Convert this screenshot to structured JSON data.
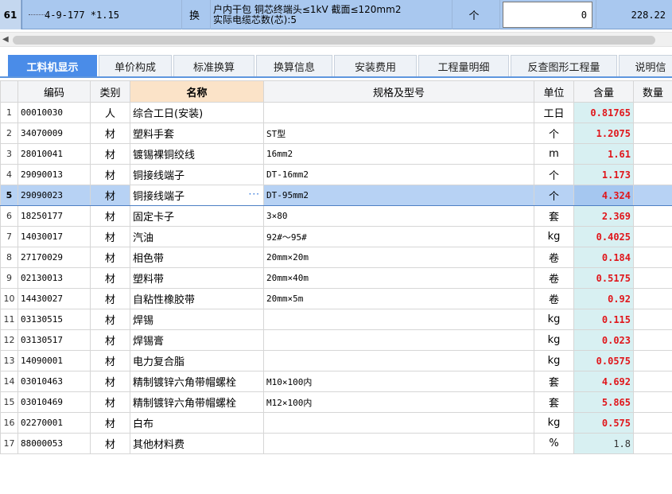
{
  "top_row": {
    "row_num": "61",
    "code": "4-9-177 *1.15",
    "mark": "换",
    "desc_line1": "户内干包 铜芯终端头≤1kV 截面≤120mm2",
    "desc_line2": "实际电缆芯数(芯):5",
    "unit": "个",
    "quantity_input": "0",
    "price": "228.22"
  },
  "tabs": [
    {
      "label": "工料机显示",
      "active": true
    },
    {
      "label": "单价构成"
    },
    {
      "label": "标准换算"
    },
    {
      "label": "换算信息"
    },
    {
      "label": "安装费用"
    },
    {
      "label": "工程量明细"
    },
    {
      "label": "反查图形工程量"
    },
    {
      "label": "说明信"
    }
  ],
  "columns": {
    "code": "编码",
    "type": "类别",
    "name": "名称",
    "spec": "规格及型号",
    "unit": "单位",
    "qty": "含量",
    "amount": "数量"
  },
  "rows": [
    {
      "n": "1",
      "code": "00010030",
      "type": "人",
      "name": "综合工日(安装)",
      "spec": "",
      "unit": "工日",
      "qty": "0.81765"
    },
    {
      "n": "2",
      "code": "34070009",
      "type": "材",
      "name": "塑料手套",
      "spec": "ST型",
      "unit": "个",
      "qty": "1.2075"
    },
    {
      "n": "3",
      "code": "28010041",
      "type": "材",
      "name": "镀锡裸铜绞线",
      "spec": "16mm2",
      "unit": "m",
      "qty": "1.61"
    },
    {
      "n": "4",
      "code": "29090013",
      "type": "材",
      "name": "铜接线端子",
      "spec": "DT-16mm2",
      "unit": "个",
      "qty": "1.173"
    },
    {
      "n": "5",
      "code": "29090023",
      "type": "材",
      "name": "铜接线端子",
      "spec": "DT-95mm2",
      "unit": "个",
      "qty": "4.324",
      "selected": true
    },
    {
      "n": "6",
      "code": "18250177",
      "type": "材",
      "name": "固定卡子",
      "spec": "3×80",
      "unit": "套",
      "qty": "2.369"
    },
    {
      "n": "7",
      "code": "14030017",
      "type": "材",
      "name": "汽油",
      "spec": "92#～95#",
      "unit": "kg",
      "qty": "0.4025"
    },
    {
      "n": "8",
      "code": "27170029",
      "type": "材",
      "name": "相色带",
      "spec": "20mm×20m",
      "unit": "卷",
      "qty": "0.184"
    },
    {
      "n": "9",
      "code": "02130013",
      "type": "材",
      "name": "塑料带",
      "spec": "20mm×40m",
      "unit": "卷",
      "qty": "0.5175"
    },
    {
      "n": "10",
      "code": "14430027",
      "type": "材",
      "name": "自粘性橡胶带",
      "spec": "20mm×5m",
      "unit": "卷",
      "qty": "0.92"
    },
    {
      "n": "11",
      "code": "03130515",
      "type": "材",
      "name": "焊锡",
      "spec": "",
      "unit": "kg",
      "qty": "0.115"
    },
    {
      "n": "12",
      "code": "03130517",
      "type": "材",
      "name": "焊锡膏",
      "spec": "",
      "unit": "kg",
      "qty": "0.023"
    },
    {
      "n": "13",
      "code": "14090001",
      "type": "材",
      "name": "电力复合脂",
      "spec": "",
      "unit": "kg",
      "qty": "0.0575"
    },
    {
      "n": "14",
      "code": "03010463",
      "type": "材",
      "name": "精制镀锌六角带帽螺栓",
      "spec": "M10×100内",
      "unit": "套",
      "qty": "4.692"
    },
    {
      "n": "15",
      "code": "03010469",
      "type": "材",
      "name": "精制镀锌六角带帽螺栓",
      "spec": "M12×100内",
      "unit": "套",
      "qty": "5.865"
    },
    {
      "n": "16",
      "code": "02270001",
      "type": "材",
      "name": "白布",
      "spec": "",
      "unit": "kg",
      "qty": "0.575"
    },
    {
      "n": "17",
      "code": "88000053",
      "type": "材",
      "name": "其他材料费",
      "spec": "",
      "unit": "%",
      "qty": "1.8",
      "plain": true
    }
  ]
}
